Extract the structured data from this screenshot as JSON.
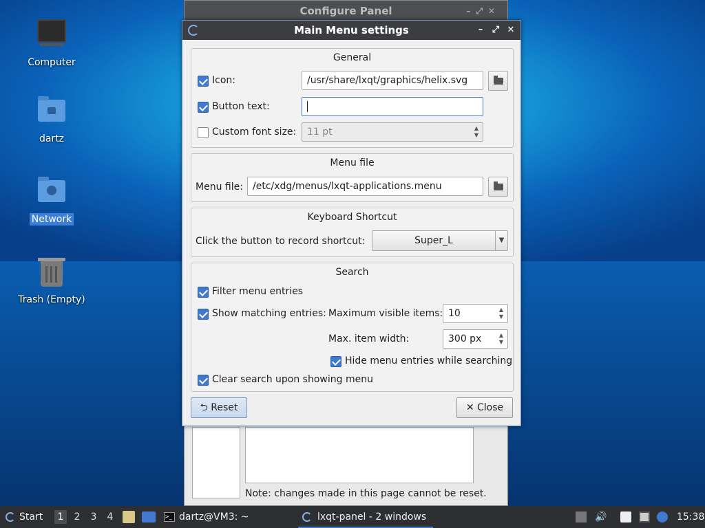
{
  "desktop": {
    "icons": [
      {
        "label": "Computer",
        "icon": "computer-icon"
      },
      {
        "label": "dartz",
        "icon": "home-folder-icon"
      },
      {
        "label": "Network",
        "icon": "network-folder-icon"
      },
      {
        "label": "Trash (Empty)",
        "icon": "trash-icon"
      }
    ]
  },
  "background_window": {
    "title": "Configure Panel",
    "note": "Note: changes made in this page cannot be reset."
  },
  "dialog": {
    "title": "Main Menu settings",
    "controls": {
      "minimize": "–",
      "maximize": "⤢",
      "close": "✕"
    },
    "general": {
      "title": "General",
      "icon_label": "Icon:",
      "icon_checked": true,
      "icon_value": "/usr/share/lxqt/graphics/helix.svg",
      "button_text_label": "Button text:",
      "button_text_checked": true,
      "button_text_value": "",
      "custom_font_label": "Custom font size:",
      "custom_font_checked": false,
      "custom_font_value": "11 pt"
    },
    "menu_file": {
      "title": "Menu file",
      "label": "Menu file:",
      "value": "/etc/xdg/menus/lxqt-applications.menu"
    },
    "shortcut": {
      "title": "Keyboard Shortcut",
      "label": "Click the button to record shortcut:",
      "value": "Super_L"
    },
    "search": {
      "title": "Search",
      "filter_label": "Filter menu entries",
      "filter_checked": true,
      "show_matching_label": "Show matching entries:",
      "show_matching_checked": true,
      "max_visible_label": "Maximum visible items:",
      "max_visible_value": "10",
      "max_width_label": "Max. item width:",
      "max_width_value": "300 px",
      "hide_entries_label": "Hide menu entries while searching",
      "hide_entries_checked": true,
      "clear_search_label": "Clear search upon showing menu",
      "clear_search_checked": true
    },
    "buttons": {
      "reset_icon": "⮌",
      "reset": "Reset",
      "close_icon": "✕",
      "close": "Close"
    }
  },
  "taskbar": {
    "start": "Start",
    "workspaces": [
      "1",
      "2",
      "3",
      "4"
    ],
    "active_workspace": "1",
    "tasks": [
      {
        "label": "dartz@VM3: ~",
        "icon": "terminal-icon"
      },
      {
        "label": "lxqt-panel - 2 windows",
        "icon": "lxqt-icon"
      }
    ],
    "clock": "15:38"
  },
  "colors": {
    "accent": "#3f7ad0",
    "titlebar": "#3b3d40",
    "taskbar": "#2d2f32"
  }
}
